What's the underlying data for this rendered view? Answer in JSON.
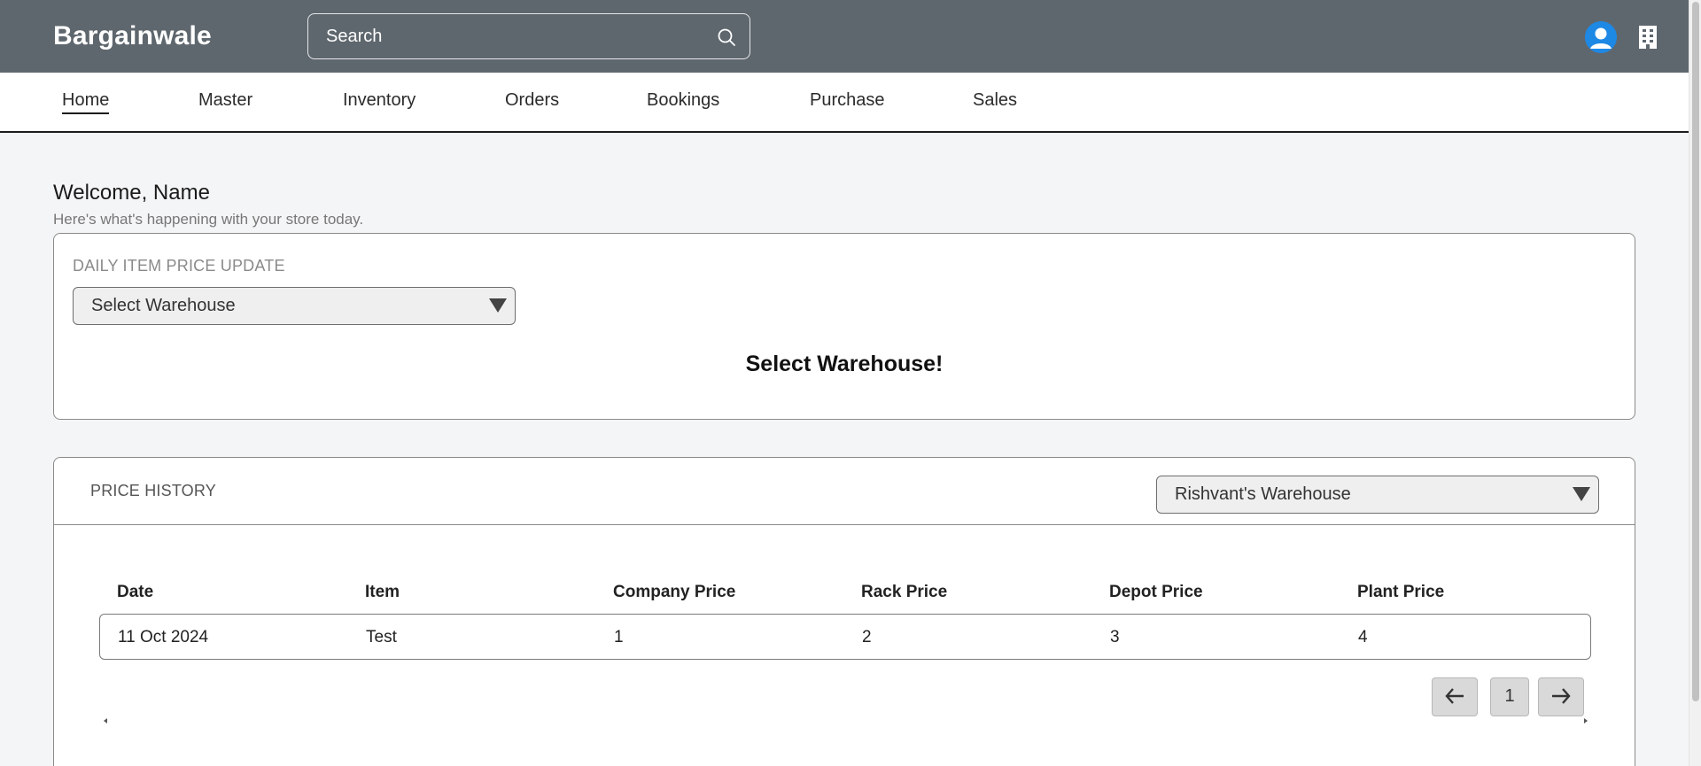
{
  "header": {
    "brand": "Bargainwale",
    "search": {
      "placeholder": "Search"
    }
  },
  "nav": {
    "items": [
      {
        "label": "Home",
        "active": true
      },
      {
        "label": "Master"
      },
      {
        "label": "Inventory"
      },
      {
        "label": "Orders"
      },
      {
        "label": "Bookings"
      },
      {
        "label": "Purchase"
      },
      {
        "label": "Sales"
      }
    ]
  },
  "welcome": {
    "title": "Welcome, Name",
    "subtitle": "Here's what's happening with your store today."
  },
  "daily_update": {
    "heading": "DAILY ITEM PRICE UPDATE",
    "warehouse_select": "Select Warehouse",
    "empty_message": "Select Warehouse!"
  },
  "price_history": {
    "heading": "PRICE HISTORY",
    "warehouse_select": "Rishvant's Warehouse",
    "columns": [
      "Date",
      "Item",
      "Company Price",
      "Rack Price",
      "Depot Price",
      "Plant Price"
    ],
    "rows": [
      [
        "11 Oct 2024",
        "Test",
        "1",
        "2",
        "3",
        "4"
      ]
    ],
    "pagination": {
      "page": "1"
    }
  },
  "colors": {
    "header_bg": "#5f676e",
    "page_bg": "#f4f5f6",
    "avatar": "#1e88e5"
  }
}
